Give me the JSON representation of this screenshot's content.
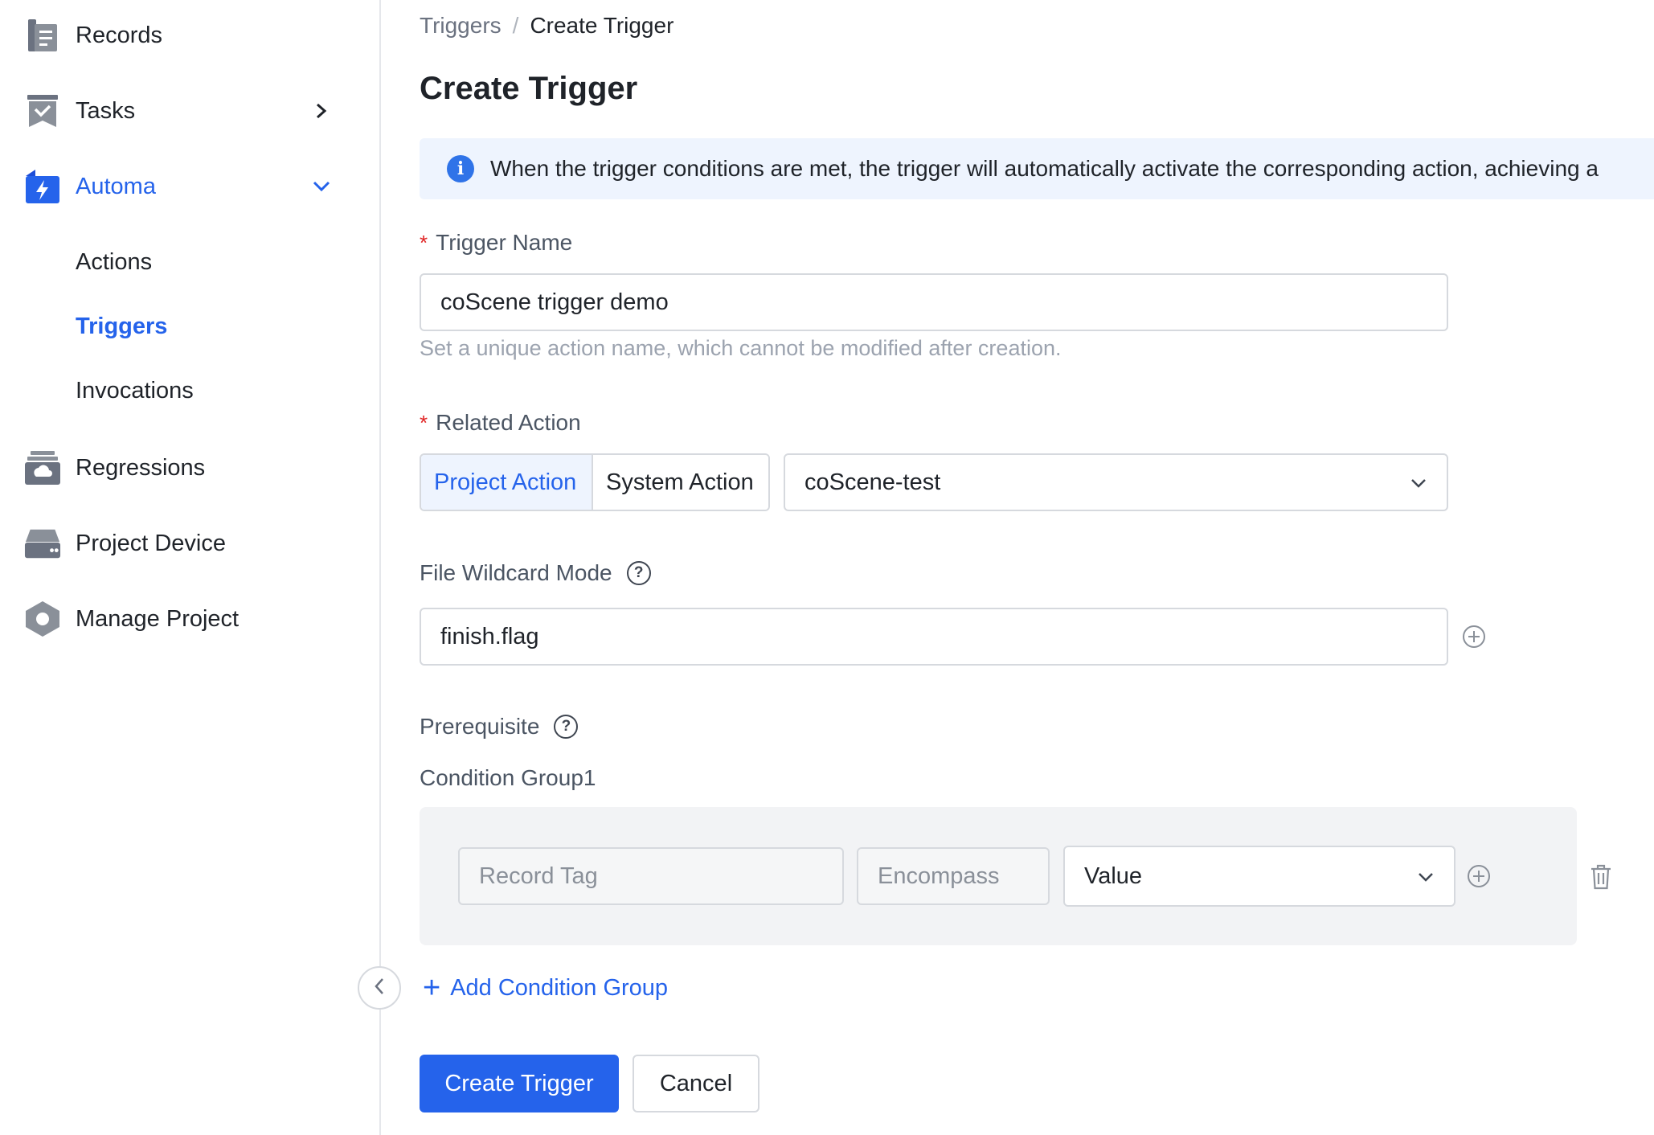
{
  "sidebar": {
    "items": [
      {
        "label": "Records",
        "icon": "records-icon"
      },
      {
        "label": "Tasks",
        "icon": "tasks-icon"
      },
      {
        "label": "Automa",
        "icon": "automa-icon"
      },
      {
        "label": "Regressions",
        "icon": "regressions-icon"
      },
      {
        "label": "Project Device",
        "icon": "device-icon"
      },
      {
        "label": "Manage Project",
        "icon": "manage-project-icon"
      }
    ],
    "automa_children": [
      {
        "label": "Actions"
      },
      {
        "label": "Triggers"
      },
      {
        "label": "Invocations"
      }
    ]
  },
  "breadcrumb": {
    "parent": "Triggers",
    "separator": "/",
    "current": "Create Trigger"
  },
  "page_title": "Create Trigger",
  "info_banner": "When the trigger conditions are met, the trigger will automatically activate the corresponding action, achieving a",
  "form": {
    "trigger_name": {
      "label": "Trigger Name",
      "required_mark": "*",
      "value": "coScene trigger demo",
      "hint": "Set a unique action name, which cannot be modified after creation."
    },
    "related_action": {
      "label": "Related Action",
      "required_mark": "*",
      "options": [
        "Project Action",
        "System Action"
      ],
      "selected_option": "Project Action",
      "action_value": "coScene-test"
    },
    "file_wildcard": {
      "label": "File Wildcard Mode",
      "value": "finish.flag"
    },
    "prerequisite": {
      "label": "Prerequisite",
      "group_label": "Condition Group1",
      "condition": {
        "field_placeholder": "Record Tag",
        "operator_placeholder": "Encompass",
        "value_placeholder": "Value"
      }
    },
    "add_condition_group": "Add Condition Group"
  },
  "buttons": {
    "create": "Create Trigger",
    "cancel": "Cancel"
  },
  "colors": {
    "accent": "#2563eb",
    "banner_bg": "#eef4fe",
    "required": "#e02424"
  }
}
